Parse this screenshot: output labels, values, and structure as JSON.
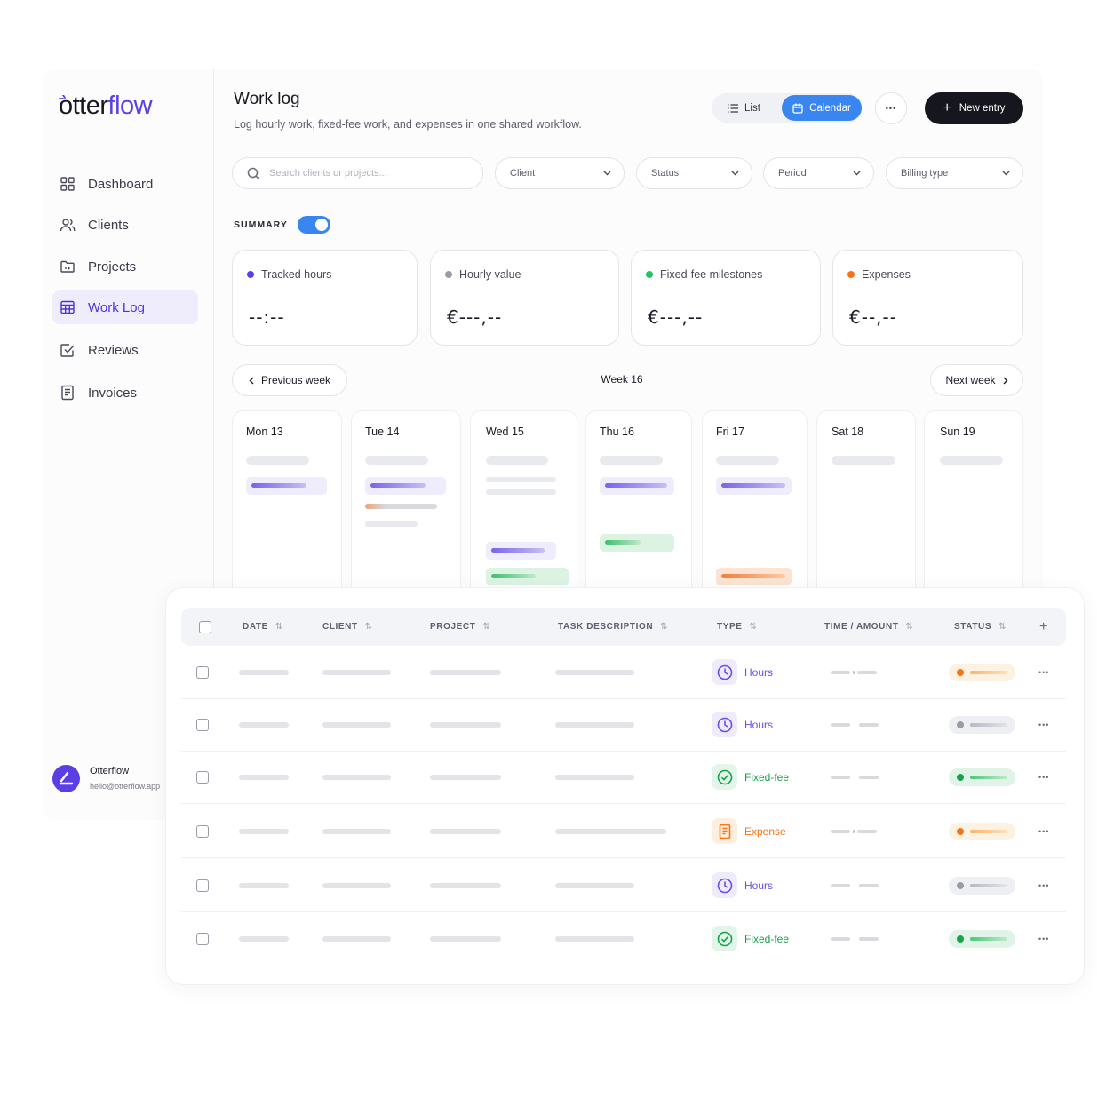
{
  "brand": {
    "part1": "otter",
    "part2": "flow"
  },
  "sidebar": {
    "items": [
      {
        "label": "Dashboard",
        "icon": "dashboard-icon"
      },
      {
        "label": "Clients",
        "icon": "users-icon"
      },
      {
        "label": "Projects",
        "icon": "folder-icon"
      },
      {
        "label": "Work Log",
        "icon": "table-grid-icon",
        "active": true
      },
      {
        "label": "Reviews",
        "icon": "check-square-icon"
      },
      {
        "label": "Invoices",
        "icon": "invoice-icon"
      }
    ],
    "user": {
      "name": "Otterflow",
      "email": "hello@otterflow.app"
    }
  },
  "header": {
    "title": "Work log",
    "subtitle": "Log hourly work, fixed-fee work, and expenses in one shared workflow.",
    "view_list": "List",
    "view_calendar": "Calendar",
    "more": "•••",
    "new_entry": "New entry"
  },
  "filters": {
    "search_placeholder": "Search clients or projects...",
    "client": "Client",
    "status": "Status",
    "period": "Period",
    "billing_type": "Billing type"
  },
  "summary": {
    "label": "SUMMARY",
    "enabled": true,
    "cards": [
      {
        "label": "Tracked hours",
        "value": "--:--",
        "color": "#5b3fe4"
      },
      {
        "label": "Hourly value",
        "value": "€---,--",
        "color": "#9a9aa8"
      },
      {
        "label": "Fixed-fee milestones",
        "value": "€---,--",
        "color": "#22c55e"
      },
      {
        "label": "Expenses",
        "value": "€--,--",
        "color": "#f97316"
      }
    ]
  },
  "week": {
    "prev": "Previous week",
    "title": "Week 16",
    "next": "Next week",
    "days": [
      "Mon 13",
      "Tue 14",
      "Wed 15",
      "Thu 16",
      "Fri 17",
      "Sat 18",
      "Sun 19"
    ]
  },
  "table": {
    "columns": [
      "DATE",
      "CLIENT",
      "PROJECT",
      "TASK DESCRIPTION",
      "TYPE",
      "TIME / AMOUNT",
      "STATUS"
    ],
    "rows": [
      {
        "type": "Hours",
        "status": "pending"
      },
      {
        "type": "Hours",
        "status": "draft"
      },
      {
        "type": "Fixed-fee",
        "status": "approved"
      },
      {
        "type": "Expense",
        "status": "pending"
      },
      {
        "type": "Hours",
        "status": "draft"
      },
      {
        "type": "Fixed-fee",
        "status": "approved"
      }
    ]
  },
  "colors": {
    "accent": "#5b3fe4",
    "primary_blue": "#3a86f0",
    "hours": "#6a4fe6",
    "fixed_fee": "#16a34a",
    "expense": "#f97316"
  }
}
